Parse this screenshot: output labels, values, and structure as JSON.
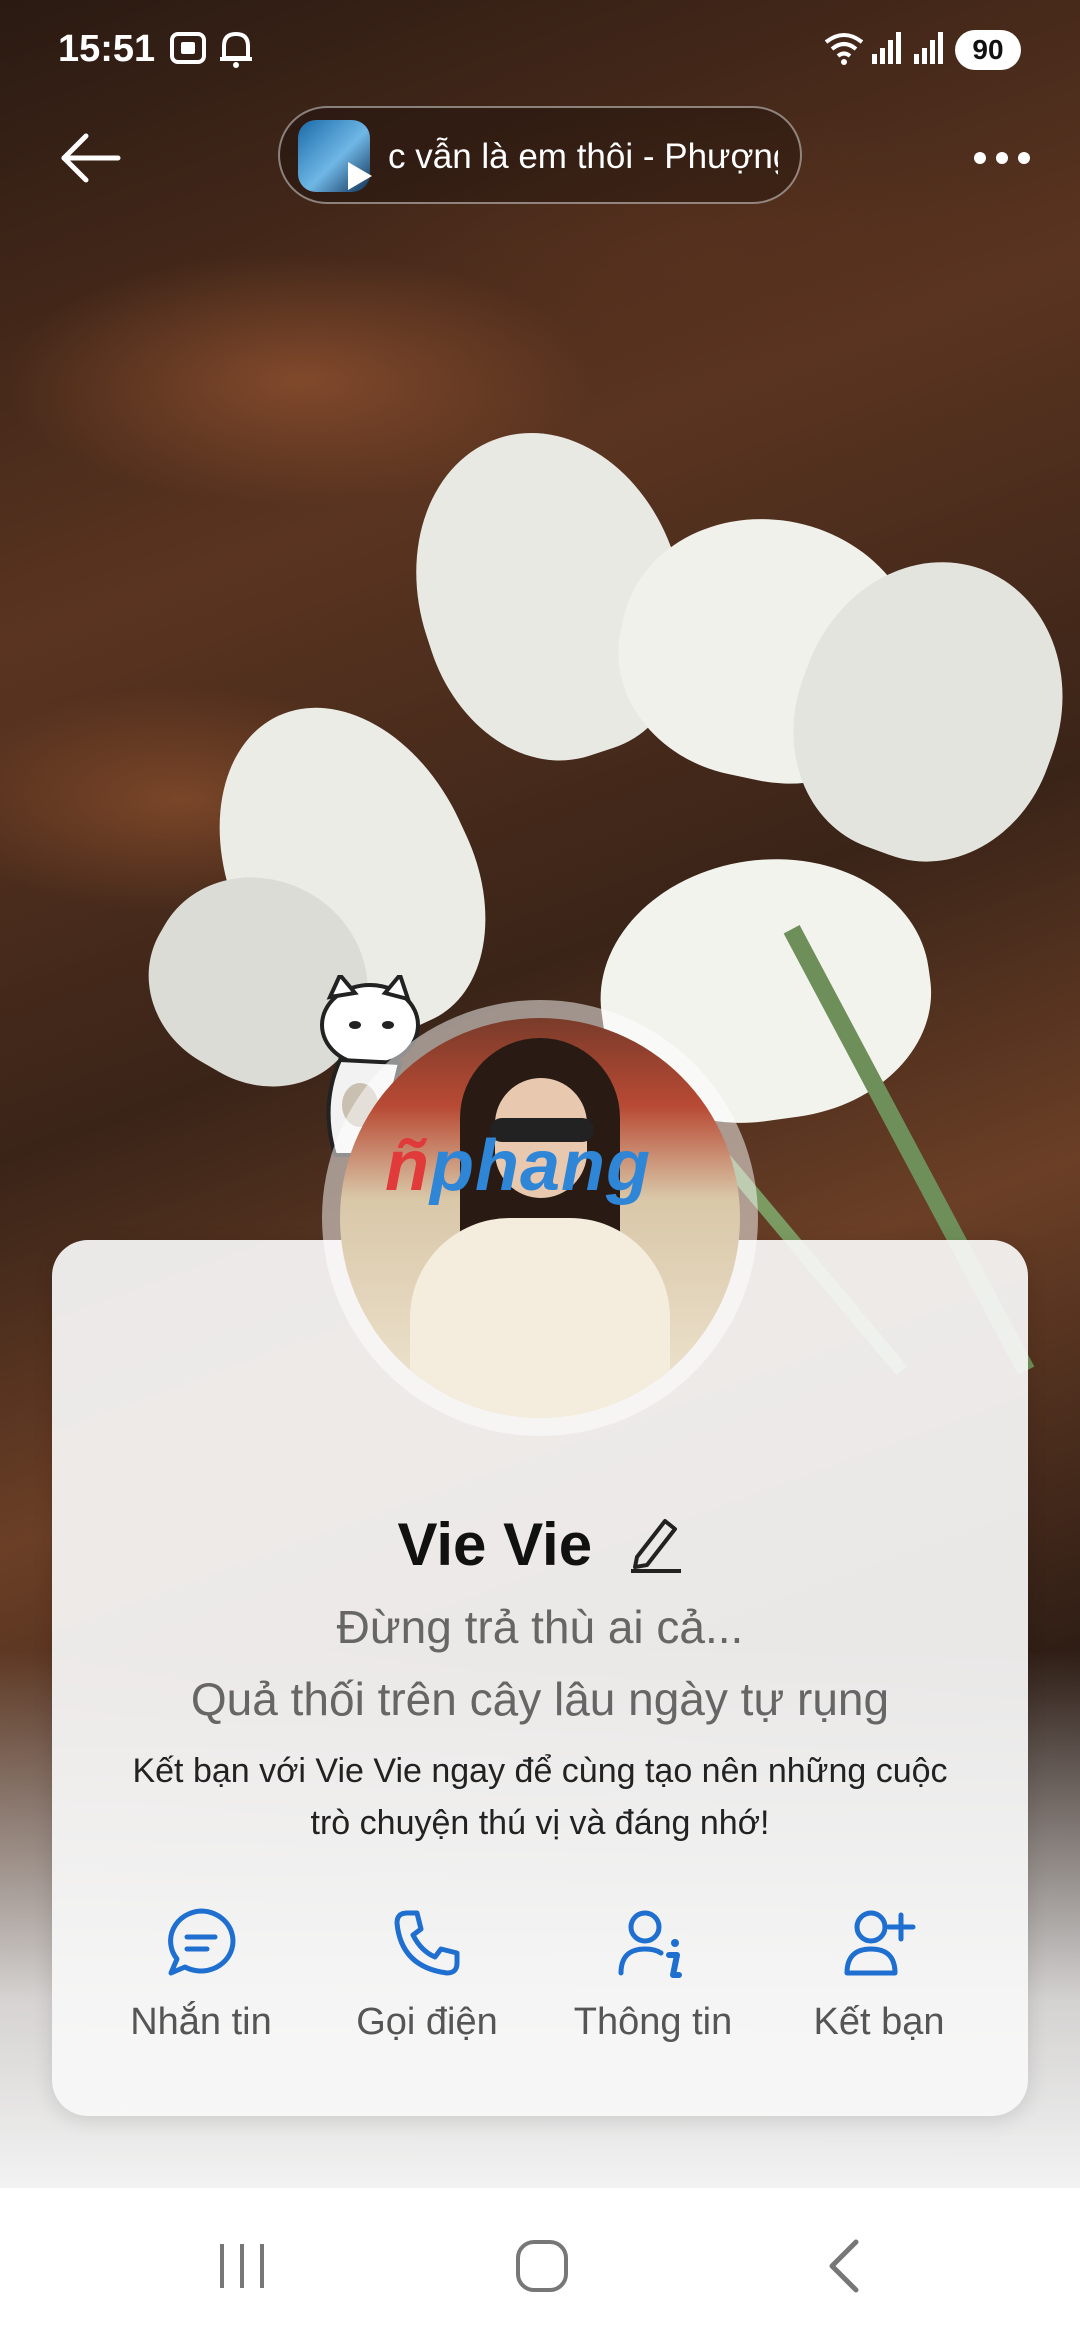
{
  "status_bar": {
    "time": "15:51",
    "battery": "90"
  },
  "header": {
    "now_playing": "c vẫn là em thôi - Phượng"
  },
  "profile": {
    "name": "Vie Vie",
    "status_line_1": "Đừng trả thù ai cả...",
    "status_line_2": "Quả thối trên cây lâu ngày tự rụng",
    "invite_line_1": "Kết bạn với Vie Vie ngay để cùng tạo nên những cuộc",
    "invite_line_2": "trò chuyện thú vị và đáng nhớ!",
    "watermark": {
      "prefix": "ñ",
      "rest": "phang"
    }
  },
  "actions": [
    {
      "label": "Nhắn tin",
      "icon": "message-icon"
    },
    {
      "label": "Gọi điện",
      "icon": "phone-icon"
    },
    {
      "label": "Thông tin",
      "icon": "user-info-icon"
    },
    {
      "label": "Kết bạn",
      "icon": "add-friend-icon"
    }
  ],
  "colors": {
    "accent": "#1e6fd0",
    "card": "#f8f8f8",
    "text_secondary": "#666666"
  }
}
